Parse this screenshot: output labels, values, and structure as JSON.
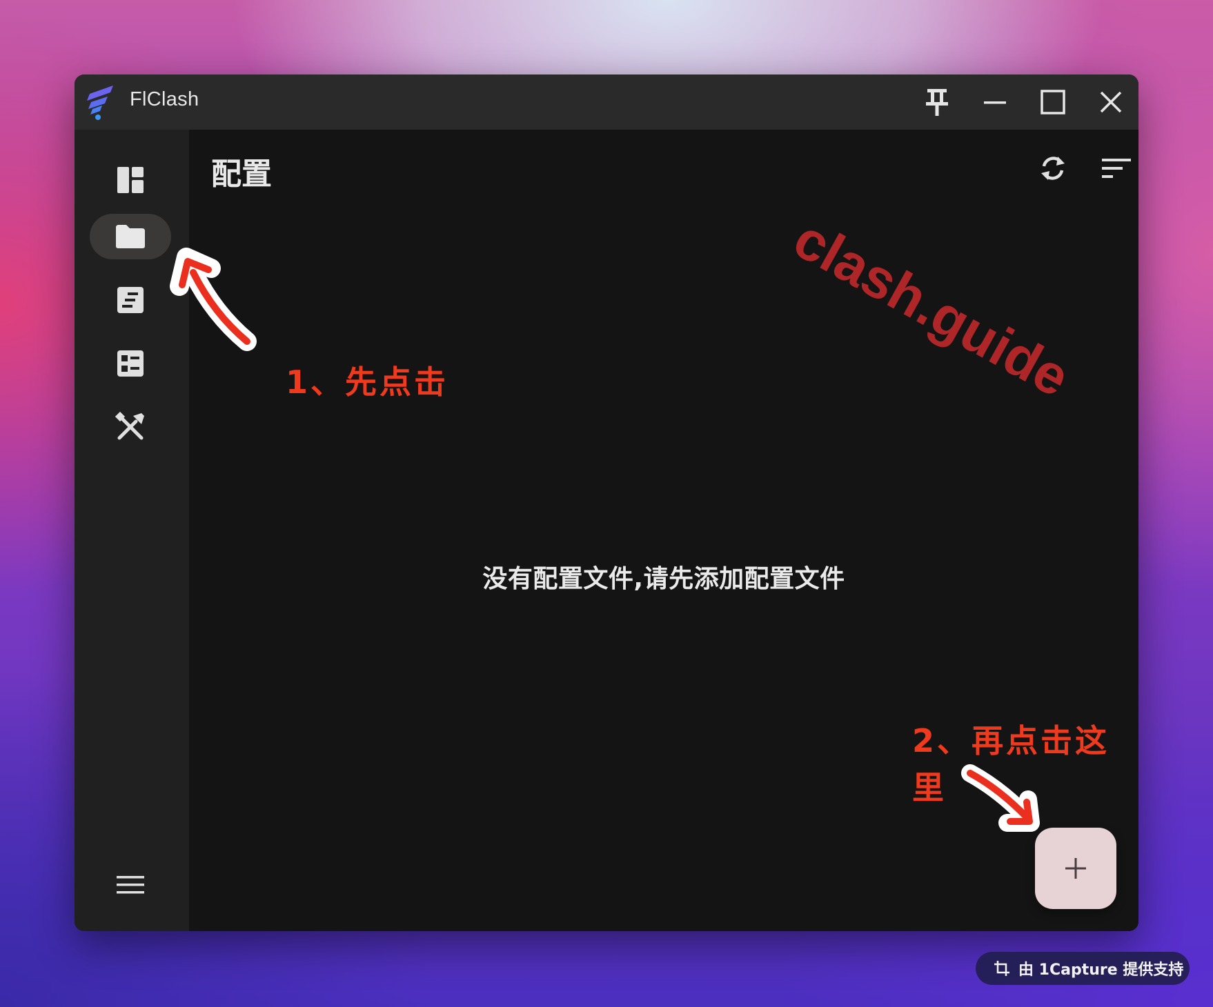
{
  "window": {
    "app_title": "FlClash",
    "controls": [
      "pin-icon",
      "minimize-icon",
      "maximize-icon",
      "close-icon"
    ]
  },
  "sidebar": {
    "items": [
      {
        "icon": "dashboard-icon",
        "active": false
      },
      {
        "icon": "folder-icon",
        "active": true
      },
      {
        "icon": "log-icon",
        "active": false
      },
      {
        "icon": "resources-icon",
        "active": false
      },
      {
        "icon": "tools-icon",
        "active": false
      }
    ],
    "bottom_icon": "menu-icon"
  },
  "page": {
    "title": "配置",
    "empty_message": "没有配置文件,请先添加配置文件",
    "header_actions": [
      "sync-icon",
      "sort-icon"
    ],
    "fab_icon": "plus-icon"
  },
  "overlay": {
    "watermark": "clash.guide",
    "annotation_1": "1、先点击",
    "annotation_2_line1": "2、再点击这",
    "annotation_2_line2": "里"
  },
  "badge": {
    "text": "由 1Capture 提供支持"
  },
  "colors": {
    "annotation": "#f03a1e",
    "watermark": "#b8282a",
    "fab": "#e7d3d6",
    "active_nav": "#3b3838"
  }
}
